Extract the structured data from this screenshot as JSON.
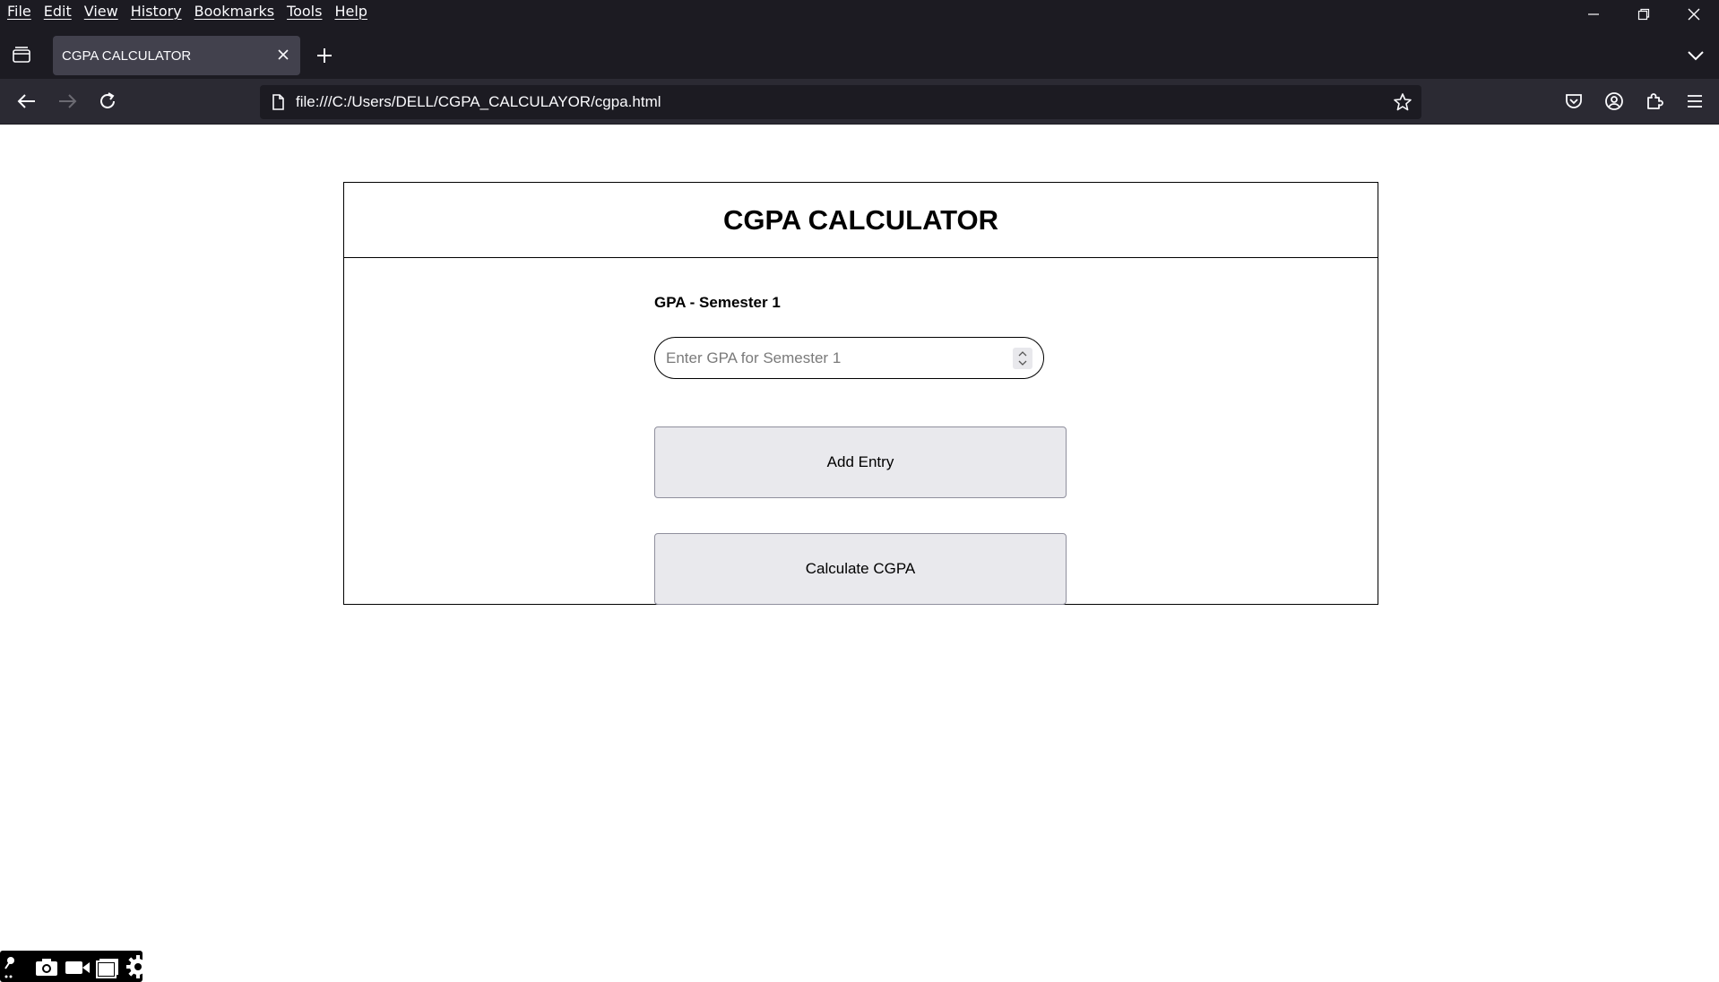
{
  "menubar": {
    "items": [
      "File",
      "Edit",
      "View",
      "History",
      "Bookmarks",
      "Tools",
      "Help"
    ]
  },
  "tab": {
    "title": "CGPA CALCULATOR"
  },
  "urlbar": {
    "url": "file:///C:/Users/DELL/CGPA_CALCULAYOR/cgpa.html"
  },
  "page": {
    "title": "CGPA CALCULATOR",
    "gpa_label": "GPA - Semester 1",
    "gpa_placeholder": "Enter GPA for Semester 1",
    "add_button": "Add Entry",
    "calc_button": "Calculate CGPA"
  },
  "colors": {
    "chrome_bg": "#1c1b22",
    "navbar_bg": "#2b2a33",
    "tab_active": "#42414d",
    "button_bg": "#e9e9ed"
  },
  "icons": {
    "capture_toolbar": [
      "pin-icon",
      "camera-icon",
      "video-icon",
      "folder-icon",
      "gear-icon"
    ]
  }
}
